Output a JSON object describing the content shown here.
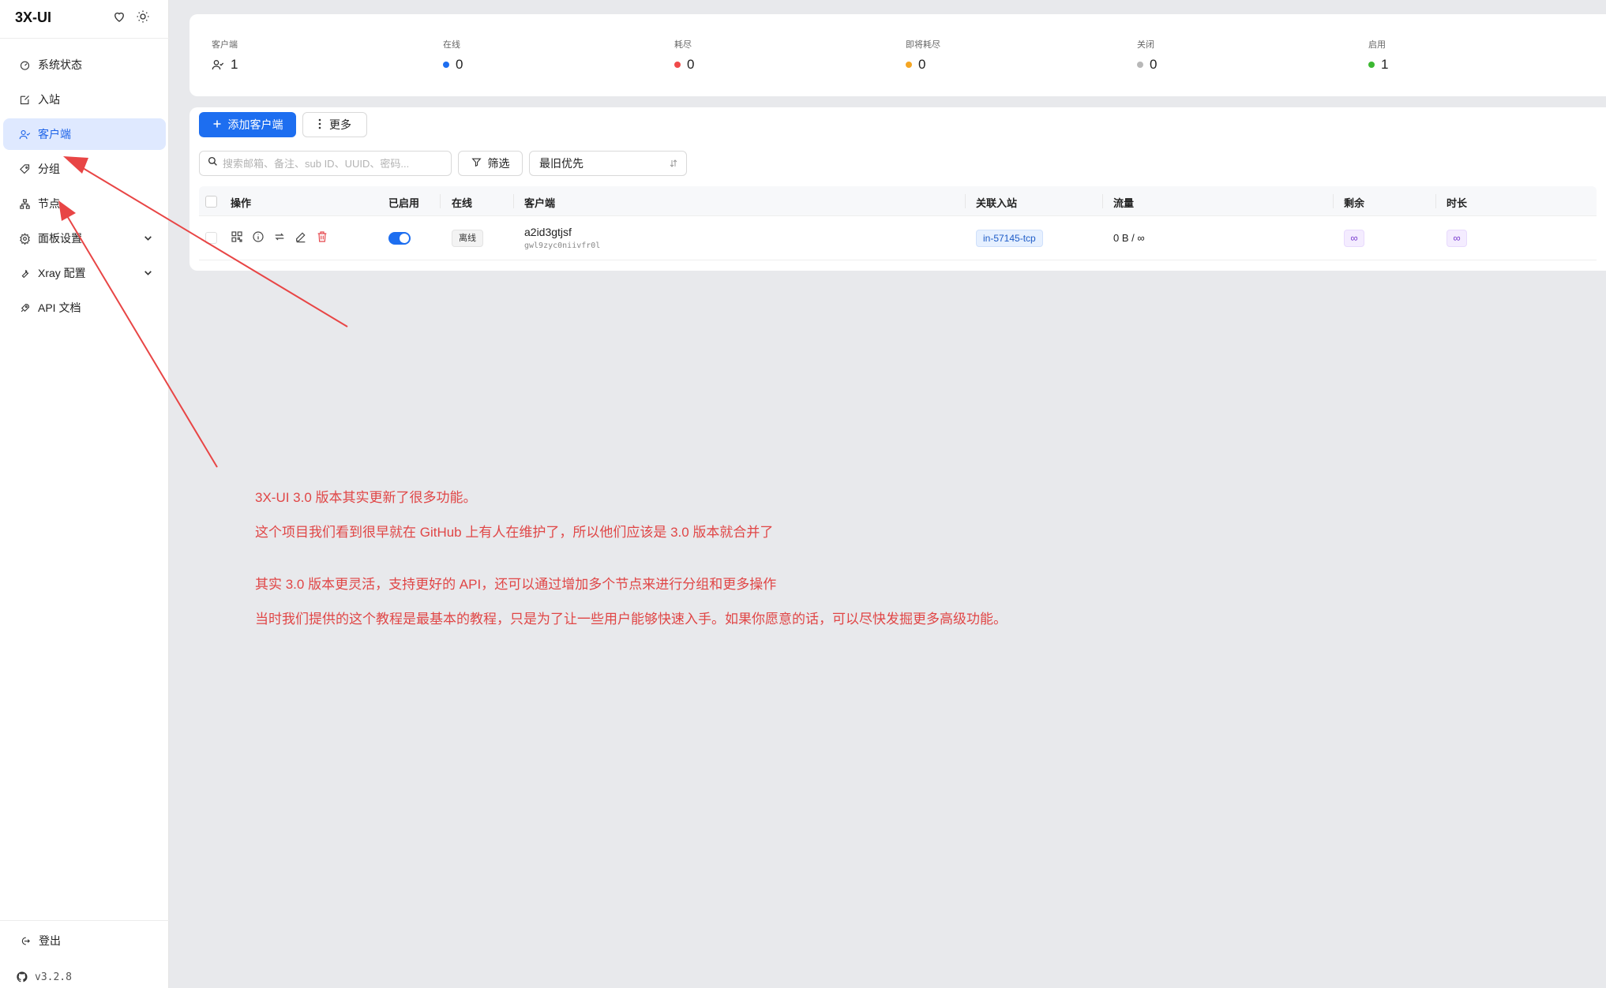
{
  "brand": {
    "title": "3X-UI"
  },
  "sidebar": {
    "items": [
      {
        "label": "系统状态",
        "icon": "dashboard-icon"
      },
      {
        "label": "入站",
        "icon": "edit-icon"
      },
      {
        "label": "客户端",
        "icon": "users-icon",
        "active": true
      },
      {
        "label": "分组",
        "icon": "tag-icon"
      },
      {
        "label": "节点",
        "icon": "cluster-icon"
      },
      {
        "label": "面板设置",
        "icon": "gear-icon",
        "expandable": true
      },
      {
        "label": "Xray 配置",
        "icon": "wrench-icon",
        "expandable": true
      },
      {
        "label": "API 文档",
        "icon": "rocket-icon"
      }
    ],
    "logout": "登出",
    "version": "v3.2.8"
  },
  "stats": [
    {
      "label": "客户端",
      "value": "1",
      "dot": null
    },
    {
      "label": "在线",
      "value": "0",
      "dot": "#1d6ef0"
    },
    {
      "label": "耗尽",
      "value": "0",
      "dot": "#f04a4a"
    },
    {
      "label": "即将耗尽",
      "value": "0",
      "dot": "#f5a623"
    },
    {
      "label": "关闭",
      "value": "0",
      "dot": "#b8b8b8"
    },
    {
      "label": "启用",
      "value": "1",
      "dot": "#3cb832"
    }
  ],
  "toolbar": {
    "add_label": "添加客户端",
    "more_label": "更多",
    "search_placeholder": "搜索邮箱、备注、sub ID、UUID、密码...",
    "filter_label": "筛选",
    "sort_value": "最旧优先"
  },
  "table": {
    "columns": [
      "操作",
      "已启用",
      "在线",
      "客户端",
      "关联入站",
      "流量",
      "剩余",
      "时长"
    ],
    "rows": [
      {
        "online": "离线",
        "client_name": "a2id3gtjsf",
        "client_sub": "gwl9zyc0niivfr0l",
        "inbound": "in-57145-tcp",
        "traffic": "0 B / ∞",
        "remaining": "∞",
        "duration": "∞"
      }
    ]
  },
  "annotation": {
    "lines": [
      "3X-UI 3.0 版本其实更新了很多功能。",
      "这个项目我们看到很早就在 GitHub 上有人在维护了，所以他们应该是 3.0 版本就合并了",
      "其实 3.0 版本更灵活，支持更好的 API，还可以通过增加多个节点来进行分组和更多操作",
      "当时我们提供的这个教程是最基本的教程，只是为了让一些用户能够快速入手。如果你愿意的话，可以尽快发掘更多高级功能。"
    ],
    "color": "#e04646"
  }
}
